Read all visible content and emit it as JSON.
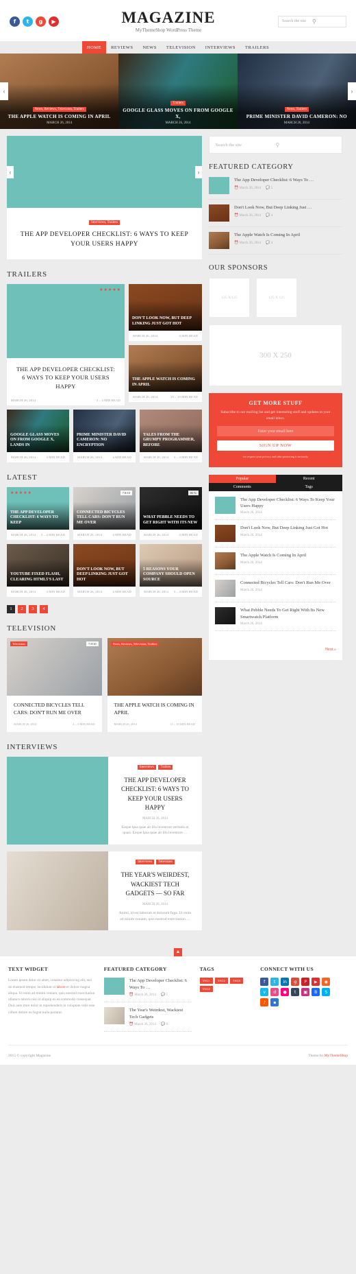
{
  "header": {
    "logo": "MAGAZINE",
    "tagline": "MyThemeShop WordPress Theme",
    "search_placeholder": "Search the site",
    "search_icon": "search-icon",
    "social": [
      {
        "name": "facebook",
        "glyph": "f",
        "color": "#3b5998"
      },
      {
        "name": "twitter",
        "glyph": "t",
        "color": "#2eb5e8"
      },
      {
        "name": "google-plus",
        "glyph": "g",
        "color": "#ef4836"
      },
      {
        "name": "youtube",
        "glyph": "▶",
        "color": "#e02f2f"
      }
    ]
  },
  "nav": {
    "items": [
      {
        "label": "HOME",
        "active": true
      },
      {
        "label": "REVIEWS",
        "active": false
      },
      {
        "label": "NEWS",
        "active": false
      },
      {
        "label": "TELEVISION",
        "active": false
      },
      {
        "label": "INTERVIEWS",
        "active": false
      },
      {
        "label": "TRAILERS",
        "active": false
      }
    ]
  },
  "slider": {
    "prev_icon": "chevron-left-icon",
    "next_icon": "chevron-right-icon",
    "slides": [
      {
        "cats": "News, Reviews, Television, Trailers",
        "title": "THE APPLE WATCH IS COMING IN APRIL",
        "date": "MARCH 26, 2014",
        "art": "art-watch"
      },
      {
        "cats": "Trailers",
        "title": "GOOGLE GLASS MOVES ON FROM GOOGLE X,",
        "date": "MARCH 26, 2014",
        "art": "art-glass"
      },
      {
        "cats": "News, Trailers",
        "title": "PRIME MINISTER DAVID CAMERON: NO",
        "date": "MARCH 26, 2014",
        "art": "art-cameron"
      }
    ]
  },
  "featured_post": {
    "cats": "Interviews, Trailers",
    "title": "THE APP DEVELOPER CHECKLIST: 6 WAYS TO KEEP YOUR USERS HAPPY",
    "prev_icon": "chevron-left-icon",
    "next_icon": "chevron-right-icon"
  },
  "sections": {
    "trailers": "TRAILERS",
    "latest": "LATEST",
    "television": "TELEVISION",
    "interviews": "INTERVIEWS"
  },
  "trailers": {
    "hero": {
      "title": "THE APP DEVELOPER CHECKLIST: 6 WAYS TO KEEP YOUR USERS HAPPY",
      "date": "MARCH 26, 2014",
      "read": "3 – 4 MIN READ",
      "stars": "★★★★★",
      "art": "art-phones"
    },
    "side": [
      {
        "title": "DON'T LOOK NOW, BUT DEEP LINKING JUST GOT HOT",
        "date": "MARCH 26, 2014",
        "read": "4 MIN READ",
        "art": "art-chain"
      },
      {
        "title": "THE APPLE WATCH IS COMING IN APRIL",
        "date": "MARCH 26, 2014",
        "read": "15 – 19 MIN READ",
        "art": "art-watch"
      }
    ],
    "row": [
      {
        "title": "GOOGLE GLASS MOVES ON FROM GOOGLE X, LANDS IN",
        "date": "MARCH 26, 2014",
        "read": "4 MIN READ",
        "art": "art-glass"
      },
      {
        "title": "PRIME MINISTER DAVID CAMERON: NO ENCRYPTION",
        "date": "MARCH 26, 2014",
        "read": "4 MIN READ",
        "art": "art-cameron"
      },
      {
        "title": "TALES FROM THE GRUMPY PROGRAMMER, BEFORE",
        "date": "MARCH 26, 2014",
        "read": "3 – 4 MIN READ",
        "art": "art-grumpy"
      }
    ]
  },
  "latest": {
    "row1": [
      {
        "title": "THE APP DEVELOPER CHECKLIST: 6 WAYS TO KEEP",
        "date": "MARCH 26, 2014",
        "read": "3 – 4 MIN READ",
        "badge": "★★★★★",
        "badge_type": "stars",
        "art": "art-phones"
      },
      {
        "title": "CONNECTED BICYCLES TELL CARS: DON'T RUN ME OVER",
        "date": "MARCH 26, 2014",
        "read": "4 MIN READ",
        "badge": "7.8/10",
        "badge_type": "rate",
        "art": "art-bike"
      },
      {
        "title": "WHAT PEBBLE NEEDS TO GET RIGHT WITH ITS NEW",
        "date": "MARCH 26, 2014",
        "read": "4 MIN READ",
        "badge": "86 %",
        "badge_type": "rate",
        "art": "art-pebble"
      }
    ],
    "row2": [
      {
        "title": "YOUTUBE FIXED FLASH, CLEARING HTML5'S LAST",
        "date": "MARCH 26, 2014",
        "read": "4 MIN READ",
        "badge": "",
        "badge_type": "",
        "art": "art-youtube"
      },
      {
        "title": "DON'T LOOK NOW, BUT DEEP LINKING JUST GOT HOT",
        "date": "MARCH 26, 2014",
        "read": "4 MIN READ",
        "badge": "",
        "badge_type": "",
        "art": "art-chain"
      },
      {
        "title": "5 REASONS YOUR COMPANY SHOULD OPEN SOURCE",
        "date": "MARCH 26, 2014",
        "read": "3 – 4 MIN READ",
        "badge": "",
        "badge_type": "",
        "art": "art-kids"
      }
    ],
    "pagination": [
      "1",
      "2",
      "3",
      "4"
    ],
    "current_page": "1"
  },
  "television": [
    {
      "title": "CONNECTED BICYCLES TELL CARS: DON'T RUN ME OVER",
      "date": "MARCH 26, 2014",
      "read": "4 – 5 MIN READ",
      "badge": "7.8/10",
      "cat": "Television",
      "art": "art-bike"
    },
    {
      "title": "THE APPLE WATCH IS COMING IN APRIL",
      "date": "MARCH 26, 2014",
      "read": "15 – 19 MIN READ",
      "badge": "",
      "cat": "News, Reviews, Television, Trailers",
      "art": "art-watch"
    }
  ],
  "interviews": [
    {
      "pills": [
        "Interviews",
        "Trailers"
      ],
      "title": "THE APP DEVELOPER CHECKLIST: 6 WAYS TO KEEP YOUR USERS HAPPY",
      "date": "MARCH 26, 2014",
      "excerpt": "Eaque ipsa quae ab illo inventore veritatis et quasi. Eaque ipsa quae ab illo inventore …",
      "art": "art-phones"
    },
    {
      "pills": [
        "Interviews",
        "Television"
      ],
      "title": "THE YEAR'S WEIRDEST, WACKIEST TECH GADGETS — SO FAR",
      "date": "MARCH 26, 2014",
      "excerpt": "Animi, id est laborum et dolorum fuga. Ut enim ad minim veniam, quis nostrud exercitation …",
      "art": "art-vr"
    }
  ],
  "sidebar": {
    "search_placeholder": "Search the site",
    "search_icon": "search-icon",
    "featured_category_title": "FEATURED CATEGORY",
    "featured_items": [
      {
        "title": "The App Developer Checklist: 6 Ways To …",
        "date": "March 26, 2014",
        "comments": "5",
        "art": "art-phones"
      },
      {
        "title": "Don't Look Now, But Deep Linking Just …",
        "date": "March 26, 2014",
        "comments": "4",
        "art": "art-chain"
      },
      {
        "title": "The Apple Watch Is Coming In April",
        "date": "March 26, 2014",
        "comments": "4",
        "art": "art-watch"
      }
    ],
    "sponsors_title": "OUR SPONSORS",
    "sponsor_boxes": [
      "125 X 125",
      "125 X 125"
    ],
    "ad_label": "300 X 250",
    "subscribe": {
      "title": "GET MORE STUFF",
      "text": "Subscribe to our mailing list and get interesting stuff and updates to your email inbox.",
      "input_placeholder": "Enter your email here",
      "button": "SIGN UP NOW",
      "fine_print": "we respect your privacy and take protecting it seriously"
    },
    "tabs": [
      {
        "label": "Popular",
        "active": true
      },
      {
        "label": "Recent",
        "active": false
      },
      {
        "label": "Comments",
        "active": false
      },
      {
        "label": "Tags",
        "active": false
      }
    ],
    "tab_items": [
      {
        "title": "The App Developer Checklist: 6 Ways To Keep Your Users Happy",
        "date": "March 26, 2014",
        "art": "art-phones"
      },
      {
        "title": "Don't Look Now, But Deep Linking Just Got Hot",
        "date": "March 26, 2014",
        "art": "art-chain"
      },
      {
        "title": "The Apple Watch Is Coming In April",
        "date": "March 26, 2014",
        "art": "art-watch"
      },
      {
        "title": "Connected Bicycles Tell Cars: Don't Run Me Over",
        "date": "March 26, 2014",
        "art": "art-bike"
      },
      {
        "title": "What Pebble Needs To Get Right With Its New Smartwatch Platform",
        "date": "March 26, 2014",
        "art": "art-pebble"
      }
    ],
    "next_label": "Next »"
  },
  "footer": {
    "back_to_top_icon": "chevron-up-icon",
    "text_widget": {
      "title": "TEXT WIDGET",
      "body_1": "Lorem ipsum dolor sit amet, consetur adipisicing elit, sed do eiusmod tempor incididunt ut ",
      "link_1": "labore",
      "body_2": " et dolore magna aliqua. Ut enim ad minim veniam, quis nostrud exercitation ullamco laboris nisi ut aliquip ex ea commodo consequat. Duis aute irure dolor in reprehenderit in voluptate velit esse cillum dolore eu fugiat nulla pariatur."
    },
    "featured_category": {
      "title": "FEATURED CATEGORY",
      "items": [
        {
          "title": "The App Developer Checklist: 6 Ways To …",
          "date": "March 26, 2014",
          "comments": "5",
          "art": "art-phones"
        },
        {
          "title": "The Year's Weirdest, Wackiest Tech Gadgets",
          "date": "March 26, 2014",
          "comments": "6",
          "art": "art-vr"
        }
      ]
    },
    "tags": {
      "title": "TAGS",
      "items": [
        "TAG1",
        "TAG2",
        "TAG3",
        "TAG4"
      ]
    },
    "connect": {
      "title": "CONNECT WITH US",
      "icons": [
        {
          "name": "facebook",
          "glyph": "f",
          "color": "#3b5998"
        },
        {
          "name": "twitter",
          "glyph": "t",
          "color": "#2eb5e8"
        },
        {
          "name": "linkedin",
          "glyph": "in",
          "color": "#0077b5"
        },
        {
          "name": "google-plus",
          "glyph": "g",
          "color": "#dd4b39"
        },
        {
          "name": "pinterest",
          "glyph": "P",
          "color": "#cb2027"
        },
        {
          "name": "youtube",
          "glyph": "▶",
          "color": "#e02f2f"
        },
        {
          "name": "rss",
          "glyph": "◉",
          "color": "#f26522"
        },
        {
          "name": "vimeo",
          "glyph": "v",
          "color": "#1ab7ea"
        },
        {
          "name": "dribbble",
          "glyph": "d",
          "color": "#ea4c89"
        },
        {
          "name": "flickr",
          "glyph": "●",
          "color": "#ff0084"
        },
        {
          "name": "tumblr",
          "glyph": "t",
          "color": "#35465c"
        },
        {
          "name": "instagram",
          "glyph": "▣",
          "color": "#c13584"
        },
        {
          "name": "behance",
          "glyph": "B",
          "color": "#1769ff"
        },
        {
          "name": "skype",
          "glyph": "S",
          "color": "#00aff0"
        },
        {
          "name": "soundcloud",
          "glyph": "♪",
          "color": "#ff5500"
        },
        {
          "name": "delicious",
          "glyph": "▪",
          "color": "#3274d1"
        }
      ]
    },
    "copyright": "2015 © copyright Magazine",
    "theme_by_prefix": "Theme by ",
    "theme_by_link": "MyThemeShop"
  }
}
